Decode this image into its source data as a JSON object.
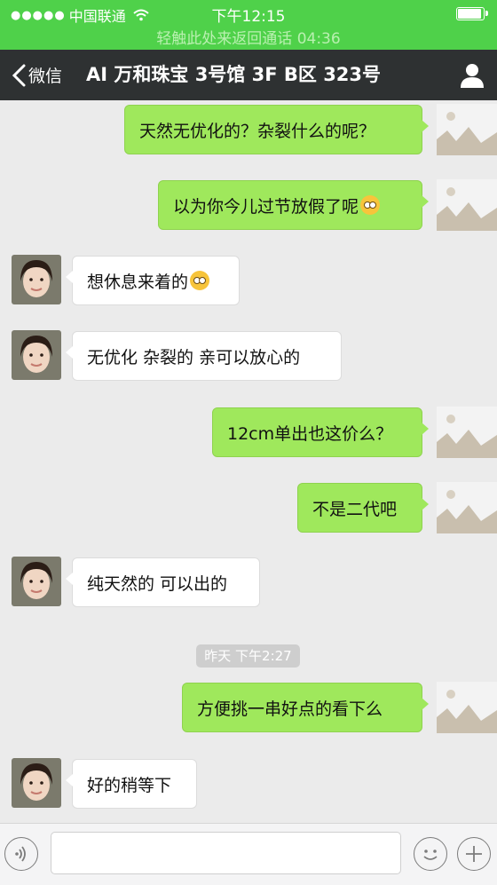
{
  "status_bar": {
    "signal": "●●●●●",
    "carrier": "中国联通",
    "wifi_icon": "wifi-icon",
    "time": "下午12:15",
    "battery_level": 0.85
  },
  "call_banner": "轻触此处来返回通话  04:36",
  "nav": {
    "back_label": "微信",
    "title": "AI 万和珠宝  3号馆 3F B区 323号",
    "profile_icon": "person-icon"
  },
  "messages": [
    {
      "from": "me",
      "text": "天然无优化的？杂裂什么的呢？"
    },
    {
      "from": "me",
      "text": "以为你今儿过节放假了呢",
      "emoji": "thinking-face"
    },
    {
      "from": "them",
      "text": "想休息来着的",
      "emoji": "flushed-face"
    },
    {
      "from": "them",
      "text": "无优化 杂裂的 亲可以放心的"
    },
    {
      "from": "me",
      "text": "12cm单出也这价么？"
    },
    {
      "from": "me",
      "text": "不是二代吧"
    },
    {
      "from": "them",
      "text": "纯天然的 可以出的"
    },
    {
      "from": "me",
      "text": "方便挑一串好点的看下么"
    },
    {
      "from": "them",
      "text": "好的稍等下"
    }
  ],
  "timestamp": "昨天  下午2:27",
  "input_bar": {
    "voice_icon": "voice-icon",
    "emoji_icon": "smiley-icon",
    "plus_icon": "plus-icon",
    "input_value": ""
  },
  "colors": {
    "status_green": "#4fd14a",
    "nav_dark": "#2e3132",
    "bubble_me": "#9fe85c",
    "bubble_them": "#ffffff",
    "chat_bg": "#ebebeb"
  }
}
